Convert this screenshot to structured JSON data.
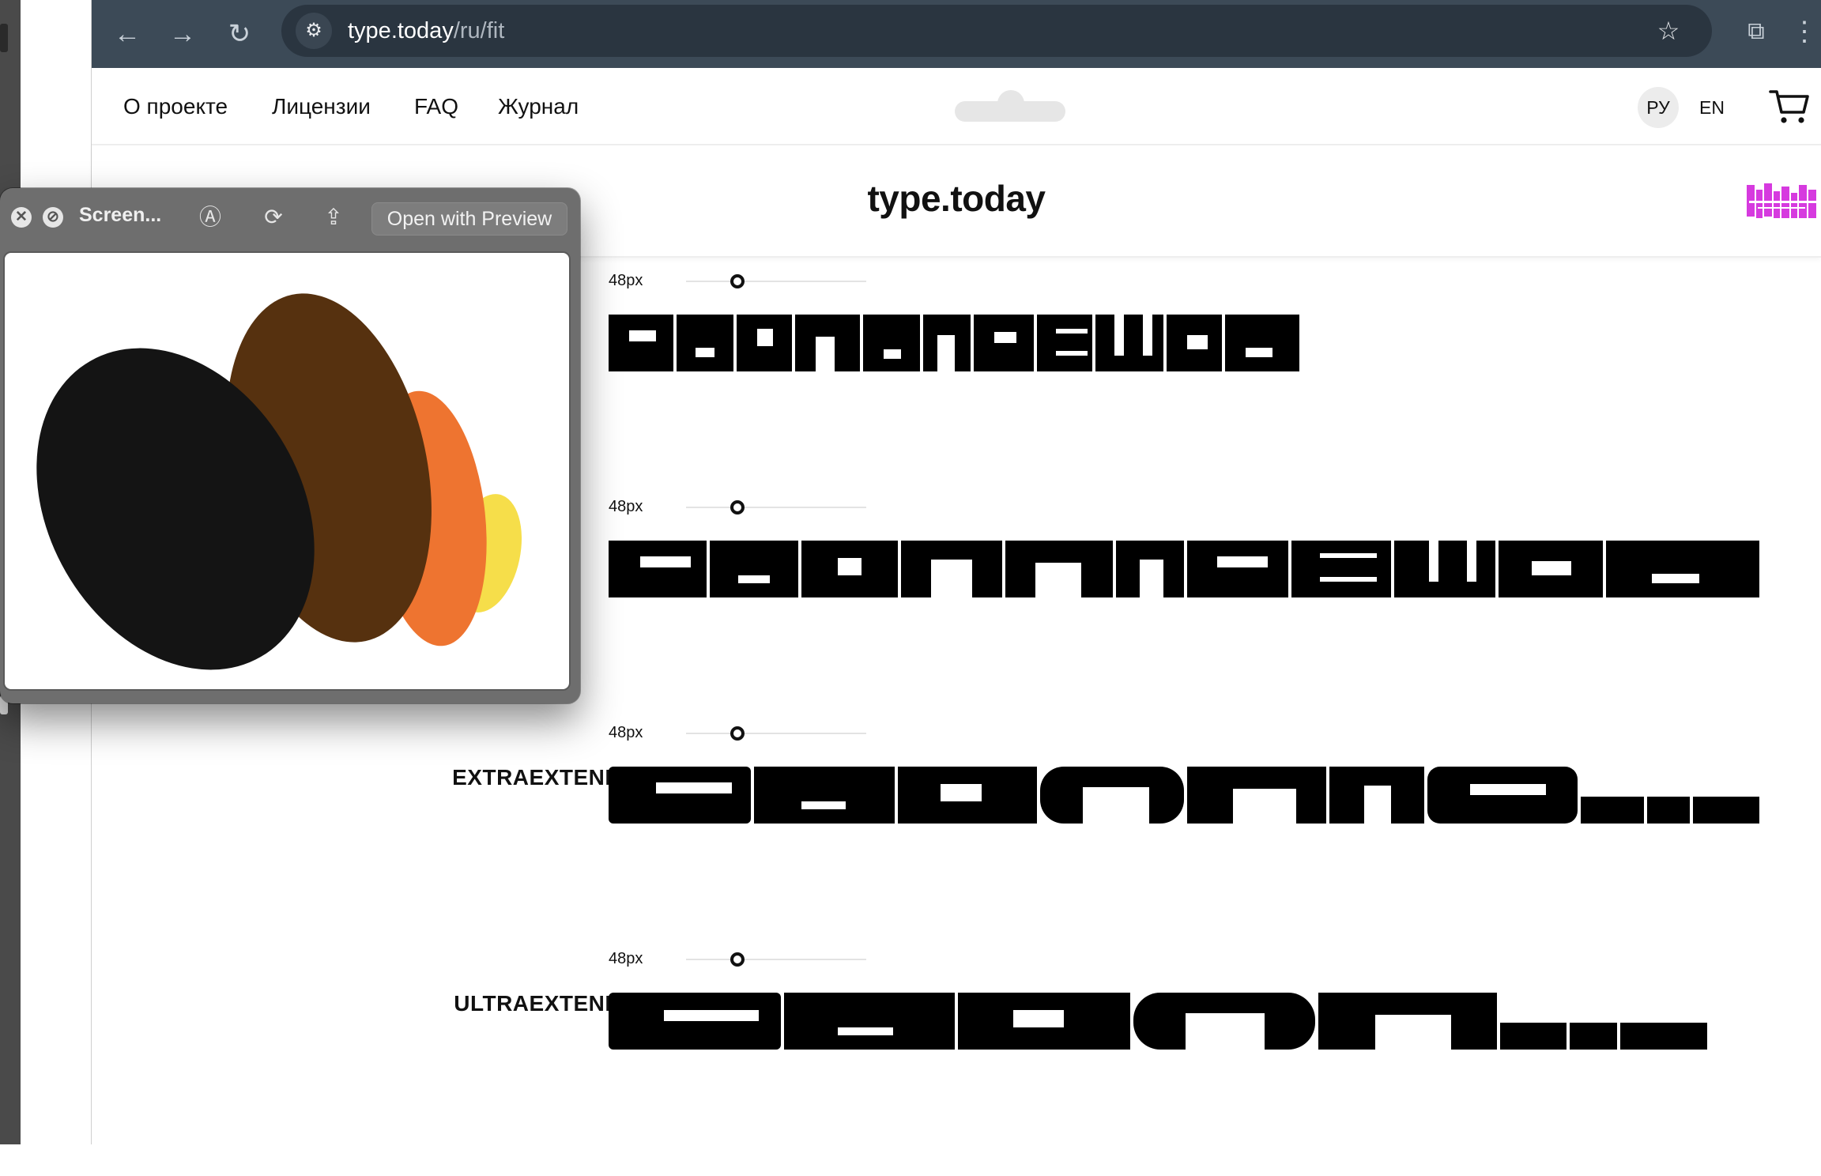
{
  "browser": {
    "url_host": "type.today",
    "url_path": "/ru/fit",
    "back_icon": "←",
    "forward_icon": "→",
    "reload_icon": "↻",
    "site_info_icon": "⚙",
    "star_icon": "☆",
    "extensions_icon": "⧉",
    "menu_icon": "⋮"
  },
  "site": {
    "nav": [
      "О проекте",
      "Лицензии",
      "FAQ",
      "Журнал"
    ],
    "lang_ru": "РУ",
    "lang_en": "EN",
    "title": "type.today",
    "colors": {
      "accent_pink": "#d63adf",
      "text": "#111111"
    }
  },
  "rows": [
    {
      "width_name": "",
      "size": "48px",
      "slider_value": 48
    },
    {
      "width_name": "",
      "size": "48px",
      "slider_value": 48
    },
    {
      "width_name": "EXTRAEXTENDED",
      "size": "48px",
      "slider_value": 48
    },
    {
      "width_name": "ULTRAEXTENDED",
      "size": "48px",
      "slider_value": 48
    }
  ],
  "quicklook": {
    "title": "Screen...",
    "open_button": "Open with Preview",
    "close_icon": "✕",
    "hide_icon": "⊘",
    "markup_icon": "Ⓐ",
    "rotate_icon": "⟳",
    "share_icon": "⇪",
    "preview_colors": [
      "#141414",
      "#56310f",
      "#ee7430",
      "#f6de4a"
    ]
  }
}
